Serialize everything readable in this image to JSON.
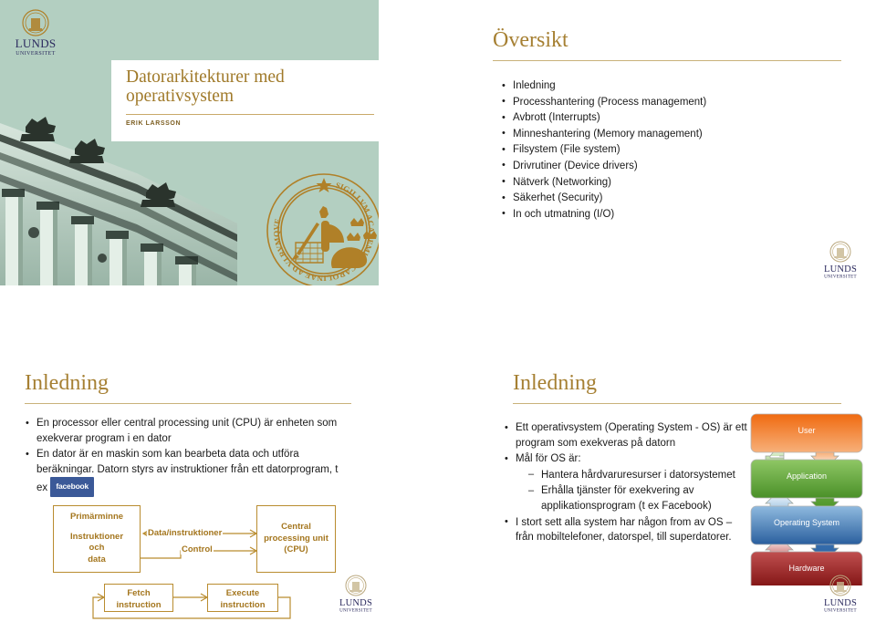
{
  "brand": {
    "name": "LUNDS",
    "subname": "UNIVERSITET",
    "green": "#b3cfc1",
    "gold": "#a68033",
    "rule": "#c9b27a",
    "navy": "#2b2a5e"
  },
  "title_slide": {
    "title": "Datorarkitekturer med operativsystem",
    "title_line1": "Datorarkitekturer med",
    "title_line2": "operativsystem",
    "author": "ERIK LARSSON",
    "logo_name": "LUNDS",
    "logo_sub": "UNIVERSITET",
    "seal_text": "SIGILLVM ACADEMIAE CAROLINAE AD VI RVMQVE"
  },
  "oversikt_slide": {
    "heading": "Översikt",
    "bullets": [
      "Inledning",
      "Processhantering (Process management)",
      "Avbrott (Interrupts)",
      "Minneshantering (Memory management)",
      "Filsystem (File system)",
      "Drivrutiner (Device drivers)",
      "Nätverk (Networking)",
      "Säkerhet (Security)",
      "In och utmatning (I/O)"
    ]
  },
  "inledning_slide_1": {
    "heading": "Inledning",
    "bullet1": "En processor eller central processing unit (CPU) är enheten som exekverar program i en dator",
    "bullet2_pre": "En dator är en maskin som kan bearbeta data och utföra beräkningar. Datorn styrs av instruktioner från ett datorprogram, t ex",
    "facebook_label": "facebook",
    "diagram": {
      "memory_title": "Primärminne",
      "memory_line1": "Instruktioner",
      "memory_line2": "och",
      "memory_line3": "data",
      "cpu_line1": "Central",
      "cpu_line2": "processing unit",
      "cpu_line3": "(CPU)",
      "edge_data": "Data/instruktioner",
      "edge_control": "Control",
      "fetch_line1": "Fetch",
      "fetch_line2": "instruction",
      "execute_line1": "Execute",
      "execute_line2": "instruction",
      "line_color": "#b98c2f",
      "text_color": "#a4761e"
    }
  },
  "inledning_slide_2": {
    "heading": "Inledning",
    "bullets": [
      {
        "level": 0,
        "text": "Ett operativsystem (Operating System - OS) är ett program som exekveras på datorn"
      },
      {
        "level": 0,
        "text": "Mål för OS är:"
      },
      {
        "level": 1,
        "text": "Hantera hårdvaruresurser i datorsystemet"
      },
      {
        "level": 1,
        "text": "Erhålla tjänster för exekvering av applikationsprogram (t ex Facebook)"
      },
      {
        "level": 0,
        "text": "I stort sett alla system har någon from av OS – från mobiltelefoner, datorspel, till superdatorer."
      }
    ],
    "stack": {
      "layers": [
        {
          "label": "User",
          "color": "#e8641a",
          "color_light": "#f4a46a"
        },
        {
          "label": "Application",
          "color": "#4a9028",
          "color_light": "#86c055"
        },
        {
          "label": "Operating System",
          "color": "#2a5f9e",
          "color_light": "#7fb0dd"
        },
        {
          "label": "Hardware",
          "color": "#8c1212",
          "color_light": "#c86a6a"
        }
      ]
    }
  }
}
